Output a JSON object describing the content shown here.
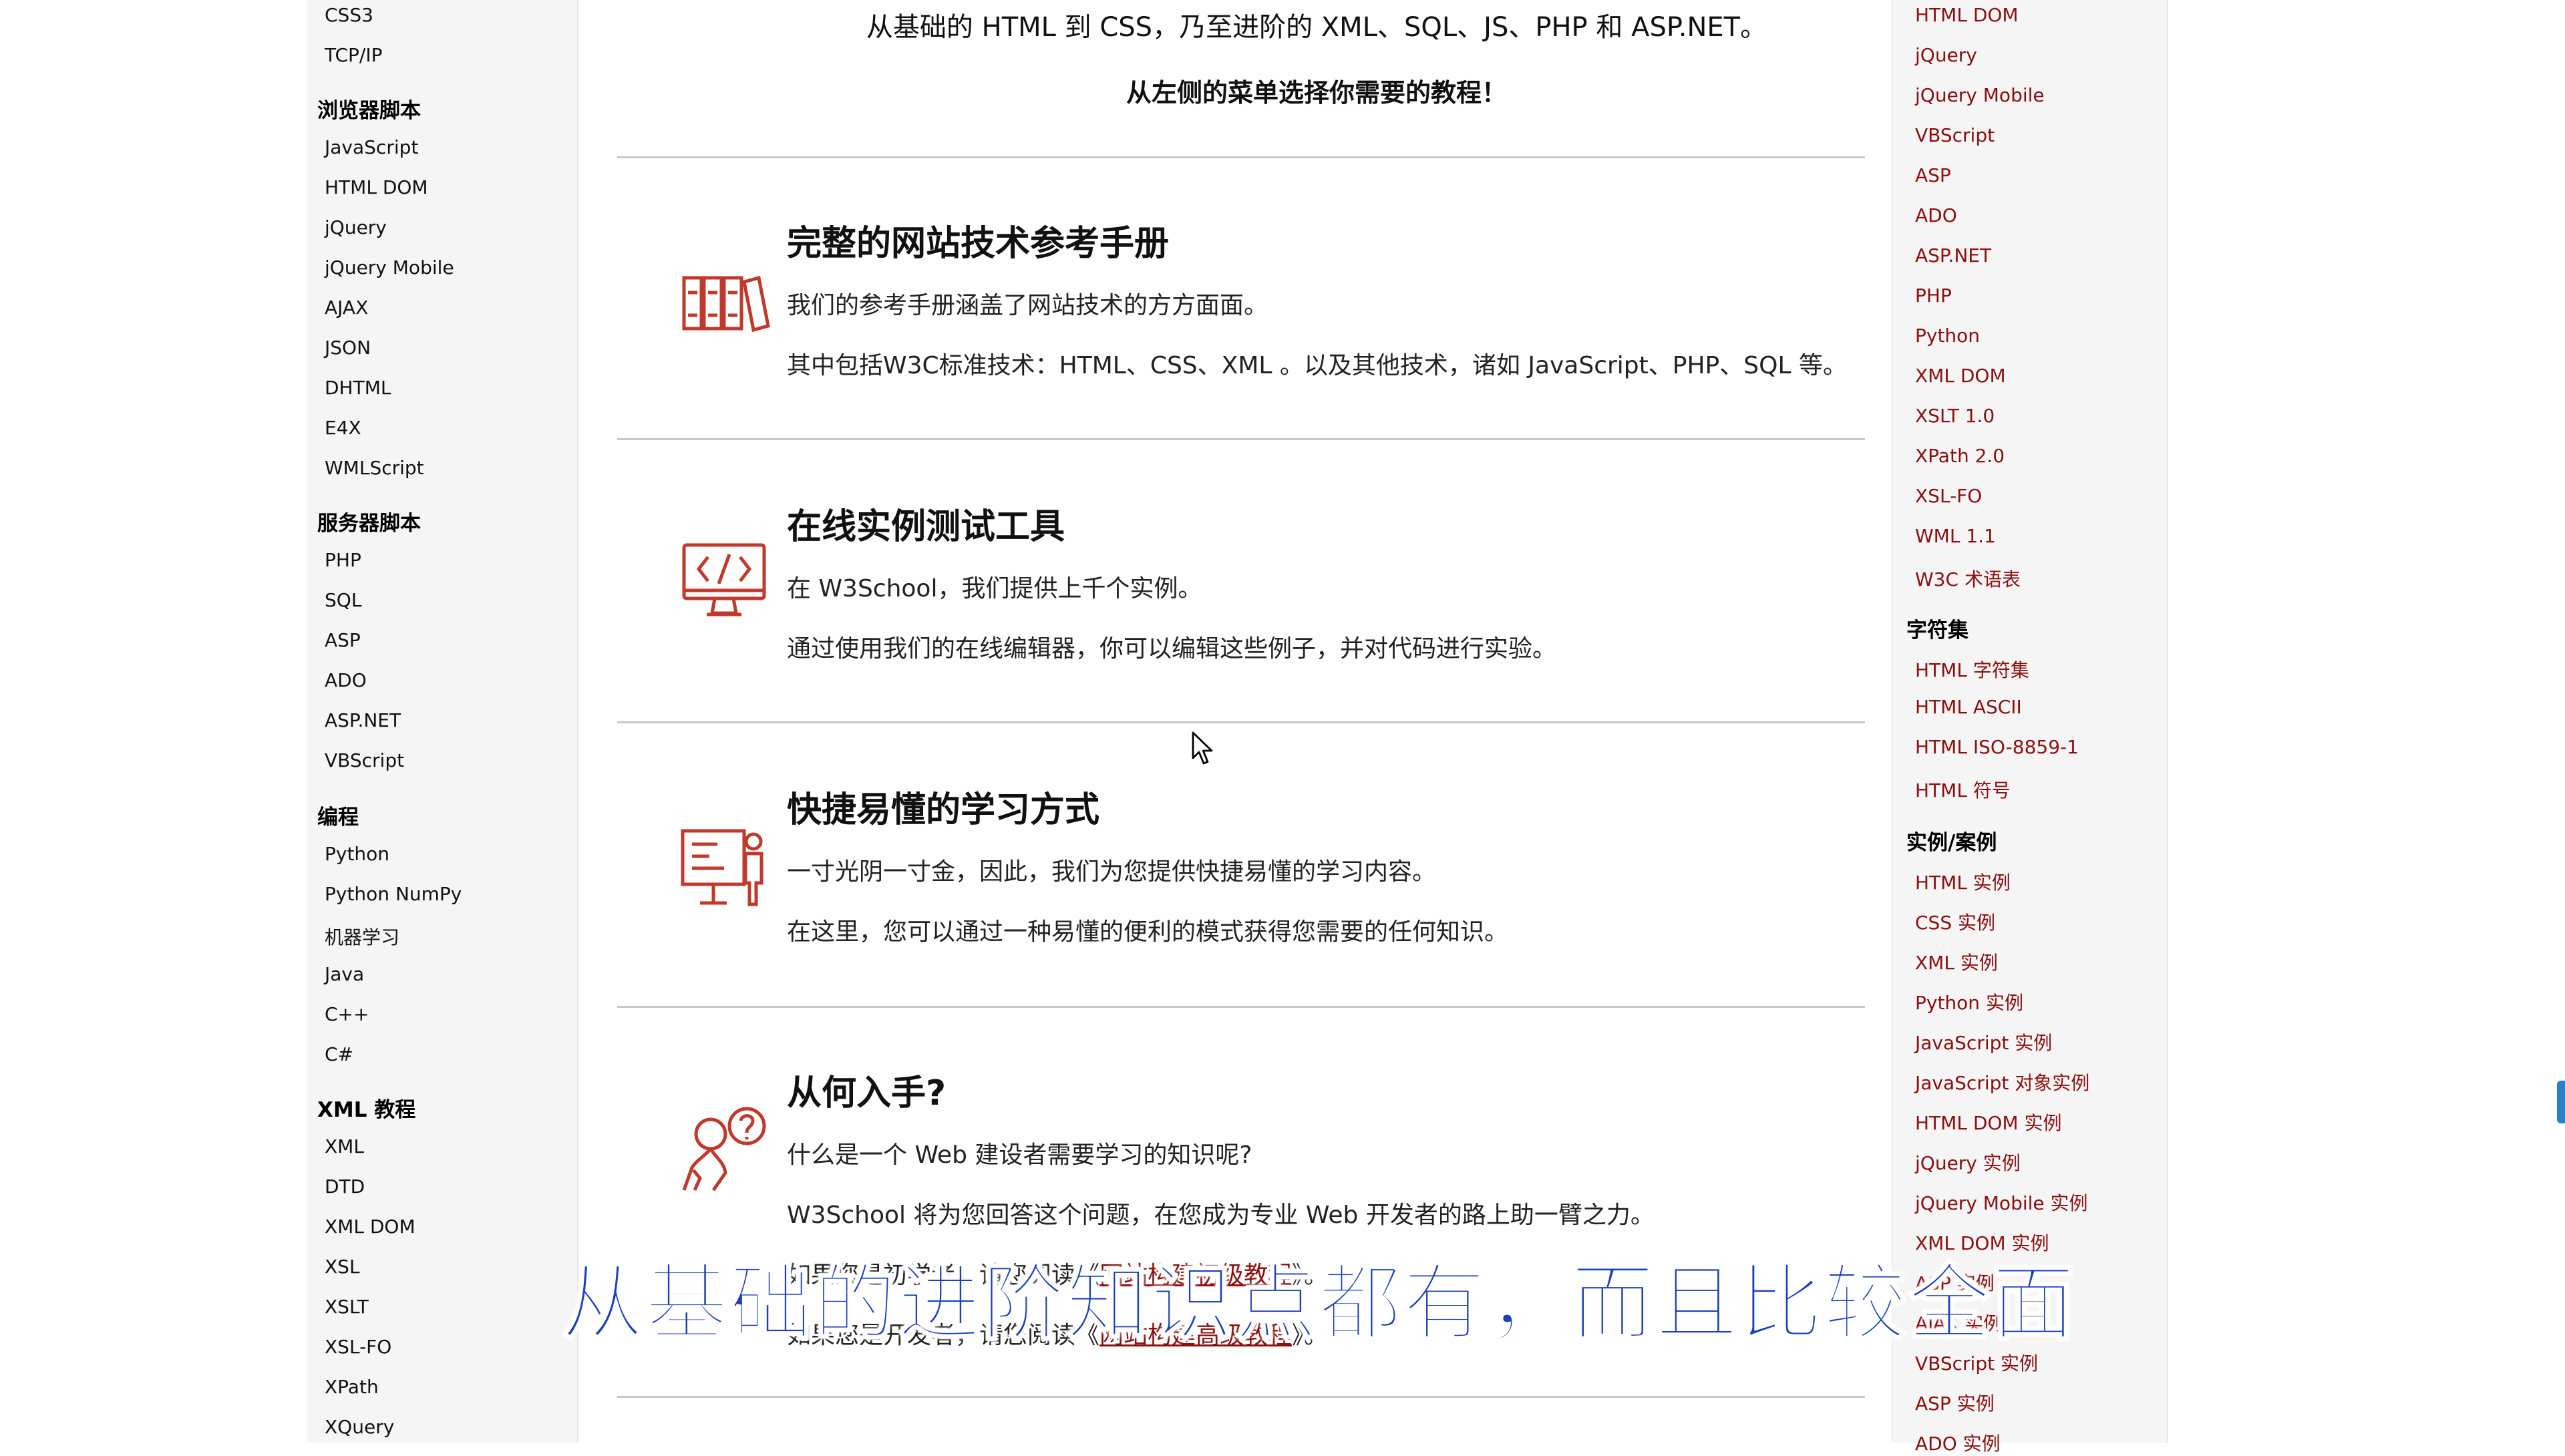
{
  "left_nav": {
    "items": [
      {
        "type": "item",
        "label": "CSS3"
      },
      {
        "type": "item",
        "label": "TCP/IP"
      },
      {
        "type": "head",
        "label": "浏览器脚本"
      },
      {
        "type": "item",
        "label": "JavaScript"
      },
      {
        "type": "item",
        "label": "HTML DOM"
      },
      {
        "type": "item",
        "label": "jQuery"
      },
      {
        "type": "item",
        "label": "jQuery Mobile"
      },
      {
        "type": "item",
        "label": "AJAX"
      },
      {
        "type": "item",
        "label": "JSON"
      },
      {
        "type": "item",
        "label": "DHTML"
      },
      {
        "type": "item",
        "label": "E4X"
      },
      {
        "type": "item",
        "label": "WMLScript"
      },
      {
        "type": "head",
        "label": "服务器脚本"
      },
      {
        "type": "item",
        "label": "PHP"
      },
      {
        "type": "item",
        "label": "SQL"
      },
      {
        "type": "item",
        "label": "ASP"
      },
      {
        "type": "item",
        "label": "ADO"
      },
      {
        "type": "item",
        "label": "ASP.NET"
      },
      {
        "type": "item",
        "label": "VBScript"
      },
      {
        "type": "head",
        "label": "编程"
      },
      {
        "type": "item",
        "label": "Python"
      },
      {
        "type": "item",
        "label": "Python NumPy"
      },
      {
        "type": "item",
        "label": "机器学习"
      },
      {
        "type": "item",
        "label": "Java"
      },
      {
        "type": "item",
        "label": "C++"
      },
      {
        "type": "item",
        "label": "C#"
      },
      {
        "type": "head",
        "label": "XML 教程"
      },
      {
        "type": "item",
        "label": "XML"
      },
      {
        "type": "item",
        "label": "DTD"
      },
      {
        "type": "item",
        "label": "XML DOM"
      },
      {
        "type": "item",
        "label": "XSL"
      },
      {
        "type": "item",
        "label": "XSLT"
      },
      {
        "type": "item",
        "label": "XSL-FO"
      },
      {
        "type": "item",
        "label": "XPath"
      },
      {
        "type": "item",
        "label": "XQuery"
      }
    ]
  },
  "right_nav": {
    "items": [
      {
        "type": "item",
        "label": "HTML DOM"
      },
      {
        "type": "item",
        "label": "jQuery"
      },
      {
        "type": "item",
        "label": "jQuery Mobile"
      },
      {
        "type": "item",
        "label": "VBScript"
      },
      {
        "type": "item",
        "label": "ASP"
      },
      {
        "type": "item",
        "label": "ADO"
      },
      {
        "type": "item",
        "label": "ASP.NET"
      },
      {
        "type": "item",
        "label": "PHP"
      },
      {
        "type": "item",
        "label": "Python"
      },
      {
        "type": "item",
        "label": "XML DOM"
      },
      {
        "type": "item",
        "label": "XSLT 1.0"
      },
      {
        "type": "item",
        "label": "XPath 2.0"
      },
      {
        "type": "item",
        "label": "XSL-FO"
      },
      {
        "type": "item",
        "label": "WML 1.1"
      },
      {
        "type": "item",
        "label": "W3C 术语表"
      },
      {
        "type": "head",
        "label": "字符集"
      },
      {
        "type": "item",
        "label": "HTML 字符集"
      },
      {
        "type": "item",
        "label": "HTML ASCII"
      },
      {
        "type": "item",
        "label": "HTML ISO-8859-1"
      },
      {
        "type": "item",
        "label": "HTML 符号"
      },
      {
        "type": "head",
        "label": "实例/案例"
      },
      {
        "type": "item",
        "label": "HTML 实例"
      },
      {
        "type": "item",
        "label": "CSS 实例"
      },
      {
        "type": "item",
        "label": "XML 实例"
      },
      {
        "type": "item",
        "label": "Python 实例"
      },
      {
        "type": "item",
        "label": "JavaScript 实例"
      },
      {
        "type": "item",
        "label": "JavaScript 对象实例"
      },
      {
        "type": "item",
        "label": "HTML DOM 实例"
      },
      {
        "type": "item",
        "label": "jQuery 实例"
      },
      {
        "type": "item",
        "label": "jQuery Mobile 实例"
      },
      {
        "type": "item",
        "label": "XML DOM 实例"
      },
      {
        "type": "item",
        "label": "ASP 实例"
      },
      {
        "type": "item",
        "label": "AJAX 实例"
      },
      {
        "type": "item",
        "label": "VBScript 实例"
      },
      {
        "type": "item",
        "label": "ASP 实例"
      },
      {
        "type": "item",
        "label": "ADO 实例"
      }
    ]
  },
  "main": {
    "intro": "从基础的 HTML 到 CSS，乃至进阶的 XML、SQL、JS、PHP 和 ASP.NET。",
    "intro_bold": "从左侧的菜单选择你需要的教程！",
    "sections": [
      {
        "icon": "books-icon",
        "title": "完整的网站技术参考手册",
        "p1": "我们的参考手册涵盖了网站技术的方方面面。",
        "p2": "其中包括W3C标准技术：HTML、CSS、XML 。以及其他技术，诸如 JavaScript、PHP、SQL 等。"
      },
      {
        "icon": "code-monitor-icon",
        "title": "在线实例测试工具",
        "p1": "在 W3School，我们提供上千个实例。",
        "p2": "通过使用我们的在线编辑器，你可以编辑这些例子，并对代码进行实验。"
      },
      {
        "icon": "presentation-icon",
        "title": "快捷易懂的学习方式",
        "p1": "一寸光阴一寸金，因此，我们为您提供快捷易懂的学习内容。",
        "p2": "在这里，您可以通过一种易懂的便利的模式获得您需要的任何知识。"
      },
      {
        "icon": "question-person-icon",
        "title": "从何入手?",
        "p1": "什么是一个 Web 建设者需要学习的知识呢?",
        "p2": "W3School 将为您回答这个问题，在您成为专业 Web 开发者的路上助一臂之力。",
        "p3_prefix": "如果您是初学者，请您阅读《",
        "p3_link": "网站构建初级教程",
        "p3_suffix": "》。",
        "p4_prefix": "如果您是开发者，请您阅读《",
        "p4_link": "网站构建高级教程",
        "p4_suffix": "》。"
      }
    ]
  },
  "subtitle": "从基础的进阶知识点都有，而且比较全面"
}
